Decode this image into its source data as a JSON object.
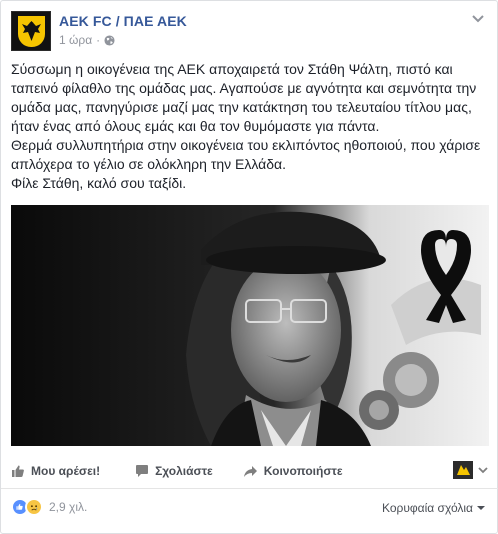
{
  "header": {
    "page_name": "AEK FC / ΠΑΕ ΑΕΚ",
    "timestamp": "1 ώρα",
    "separator": "·",
    "audience_icon": "globe-icon",
    "options_icon": "chevron-down-icon",
    "avatar_icon": "aek-eagle-logo"
  },
  "post": {
    "paragraphs": [
      "Σύσσωμη η οικογένεια της ΑΕΚ αποχαιρετά τον Στάθη Ψάλτη, πιστό και ταπεινό φίλαθλο της ομάδας μας. Αγαπούσε με αγνότητα και σεμνότητα την ομάδα μας, πανηγύρισε μαζί μας την κατάκτηση του τελευταίου τίτλου μας, ήταν ένας από όλους εμάς και θα τον θυμόμαστε για πάντα.",
      "Θερμά συλλυπητήρια στην οικογένεια του εκλιπόντος ηθοποιού, που χάρισε απλόχερα το γέλιο σε ολόκληρη την Ελλάδα.",
      "Φίλε Στάθη, καλό σου ταξίδι."
    ],
    "photo_icons": [
      "black-ribbon-icon"
    ]
  },
  "actions": {
    "like_label": "Μου αρέσει!",
    "comment_label": "Σχολιάστε",
    "share_label": "Κοινοποιήστε",
    "like_icon": "thumbs-up-icon",
    "comment_icon": "comment-icon",
    "share_icon": "share-arrow-icon"
  },
  "reactions": {
    "count": "2,9 χιλ.",
    "types": [
      "like",
      "sad"
    ],
    "top_comments_label": "Κορυφαία σχόλια"
  },
  "colors": {
    "link_blue": "#365899",
    "meta_gray": "#90949c",
    "action_gray": "#4b4f56",
    "like_blue": "#5890ff",
    "sad_yellow": "#f7c544",
    "aek_yellow": "#f5c400"
  }
}
